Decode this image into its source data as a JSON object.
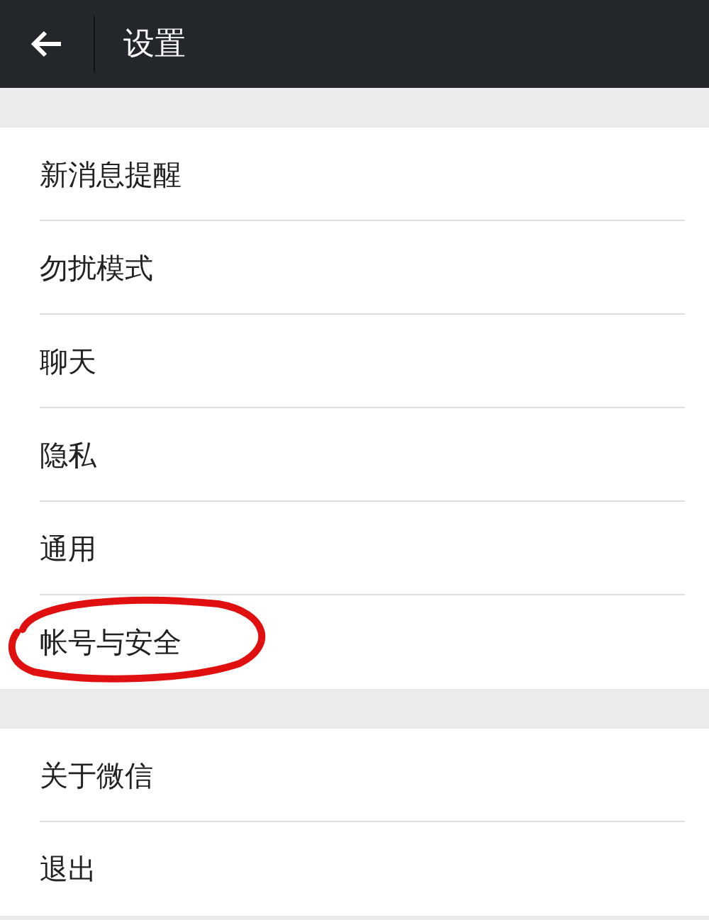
{
  "header": {
    "title": "设置"
  },
  "sections": [
    {
      "items": [
        {
          "label": "新消息提醒",
          "circled": false
        },
        {
          "label": "勿扰模式",
          "circled": false
        },
        {
          "label": "聊天",
          "circled": false
        },
        {
          "label": "隐私",
          "circled": false
        },
        {
          "label": "通用",
          "circled": false
        },
        {
          "label": "帐号与安全",
          "circled": true
        }
      ]
    },
    {
      "items": [
        {
          "label": "关于微信",
          "circled": false
        },
        {
          "label": "退出",
          "circled": false
        }
      ]
    }
  ]
}
